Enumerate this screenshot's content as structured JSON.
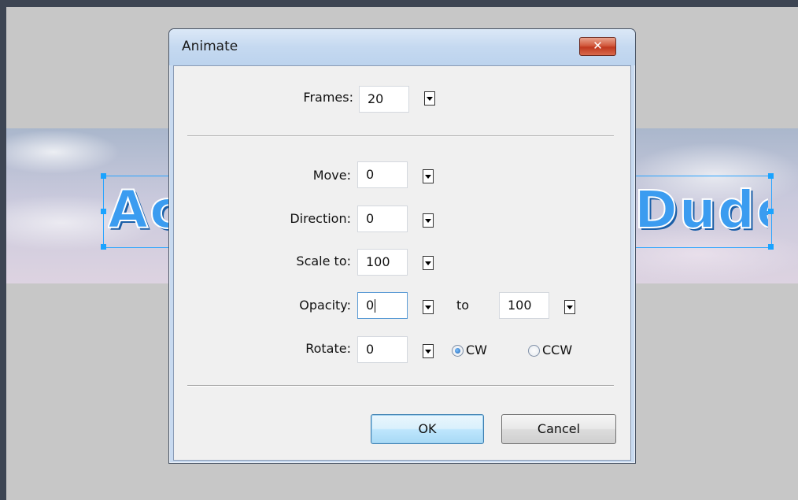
{
  "dialog": {
    "title": "Animate",
    "close_icon": "close-x-icon",
    "frames": {
      "label": "Frames:",
      "value": "20"
    },
    "move": {
      "label": "Move:",
      "value": "0"
    },
    "direction": {
      "label": "Direction:",
      "value": "0"
    },
    "scale": {
      "label": "Scale to:",
      "value": "100"
    },
    "opacity": {
      "label": "Opacity:",
      "from": "0",
      "to_label": "to",
      "to": "100"
    },
    "rotate": {
      "label": "Rotate:",
      "value": "0",
      "cw": "CW",
      "ccw": "CCW",
      "selected": "CW"
    },
    "ok_label": "OK",
    "cancel_label": "Cancel"
  },
  "canvas": {
    "banner_left_text": "Ac",
    "banner_right_text": "Dude"
  },
  "colors": {
    "desktop": "#3d4553",
    "canvas": "#c7c7c7",
    "selection": "#2aa4ff",
    "text_fill": "#3b9cf0"
  }
}
